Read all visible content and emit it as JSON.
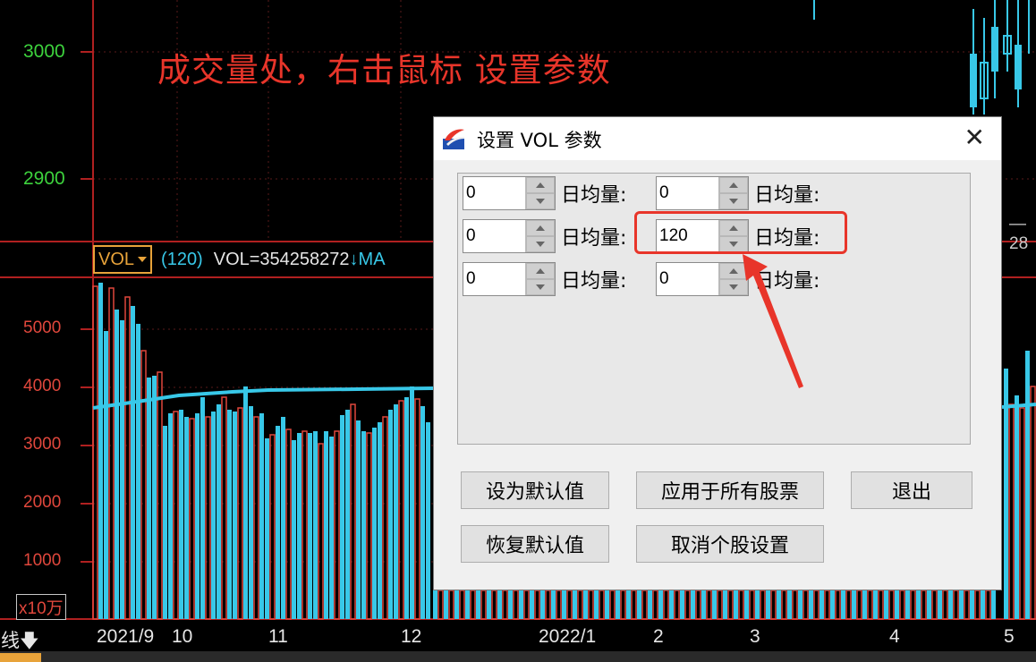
{
  "price_axis": [
    "3000",
    "2900"
  ],
  "vol_axis": [
    "5000",
    "4000",
    "3000",
    "2000",
    "1000"
  ],
  "unit_label": "x10万",
  "annotation": "成交量处，右击鼠标 设置参数",
  "vol_header": {
    "button_label": "VOL",
    "param": "(120)",
    "value": "VOL=354258272",
    "arrow": "↓",
    "ma_partial": "MA"
  },
  "right_partial_label": "28",
  "period_label": "日线",
  "dates": [
    "2021/9",
    "10",
    "11",
    "12",
    "2022/1",
    "2",
    "3",
    "4",
    "5"
  ],
  "dialog": {
    "title": "设置 VOL 参数",
    "close_glyph": "✕",
    "unit": "日均量:",
    "fields": [
      "0",
      "0",
      "0",
      "120",
      "0",
      "0"
    ],
    "buttons": {
      "set_default": "设为默认值",
      "apply_all": "应用于所有股票",
      "exit": "退出",
      "restore_default": "恢复默认值",
      "cancel_stock": "取消个股设置"
    }
  },
  "colors": {
    "cyan": "#38c8e8",
    "red": "#e0473c",
    "green": "#3dd23d",
    "highlight": "#e8352a"
  }
}
